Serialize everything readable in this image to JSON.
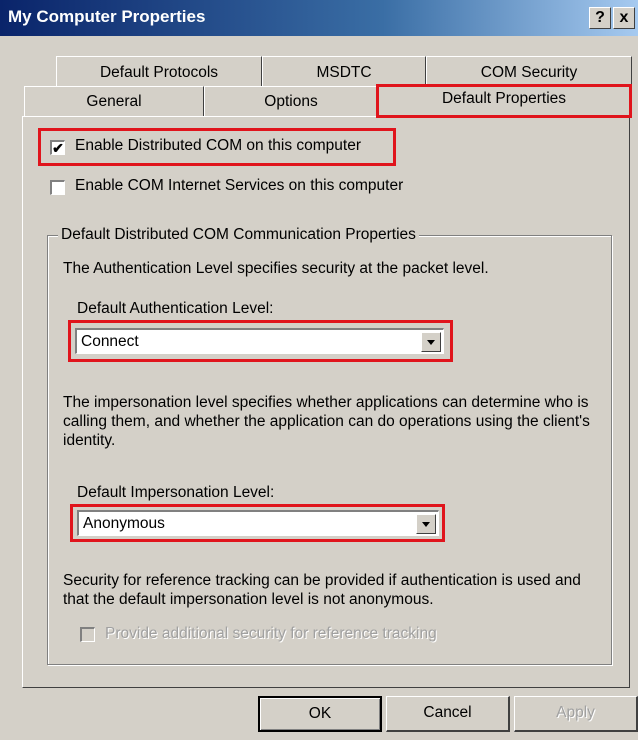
{
  "window": {
    "title": "My Computer Properties",
    "help_button": "?",
    "close_button": "x"
  },
  "tabs": {
    "row_back": [
      "Default Protocols",
      "MSDTC",
      "COM Security"
    ],
    "row_front": [
      "General",
      "Options",
      "Default Properties"
    ],
    "active": "Default Properties"
  },
  "options": {
    "enable_dcom": {
      "label": "Enable Distributed COM on this computer",
      "checked": true
    },
    "enable_cis": {
      "label": "Enable COM Internet Services on this computer",
      "checked": false
    }
  },
  "group": {
    "legend": "Default Distributed COM Communication Properties",
    "auth_description": "The Authentication Level specifies security at the packet level.",
    "auth_label": "Default Authentication Level:",
    "auth_value": "Connect",
    "imp_description": "The impersonation level specifies whether applications can determine who is calling them, and whether the application can do operations using the client's identity.",
    "imp_label": "Default Impersonation Level:",
    "imp_value": "Anonymous",
    "ref_description": "Security for reference tracking can be provided if authentication is used and that the default impersonation level is not anonymous.",
    "ref_checkbox_label": "Provide additional security for reference tracking"
  },
  "buttons": {
    "ok": "OK",
    "cancel": "Cancel",
    "apply": "Apply"
  },
  "colors": {
    "highlight_border": "#e0141c",
    "titlebar": "#0a246a",
    "face": "#d4d0c8"
  }
}
